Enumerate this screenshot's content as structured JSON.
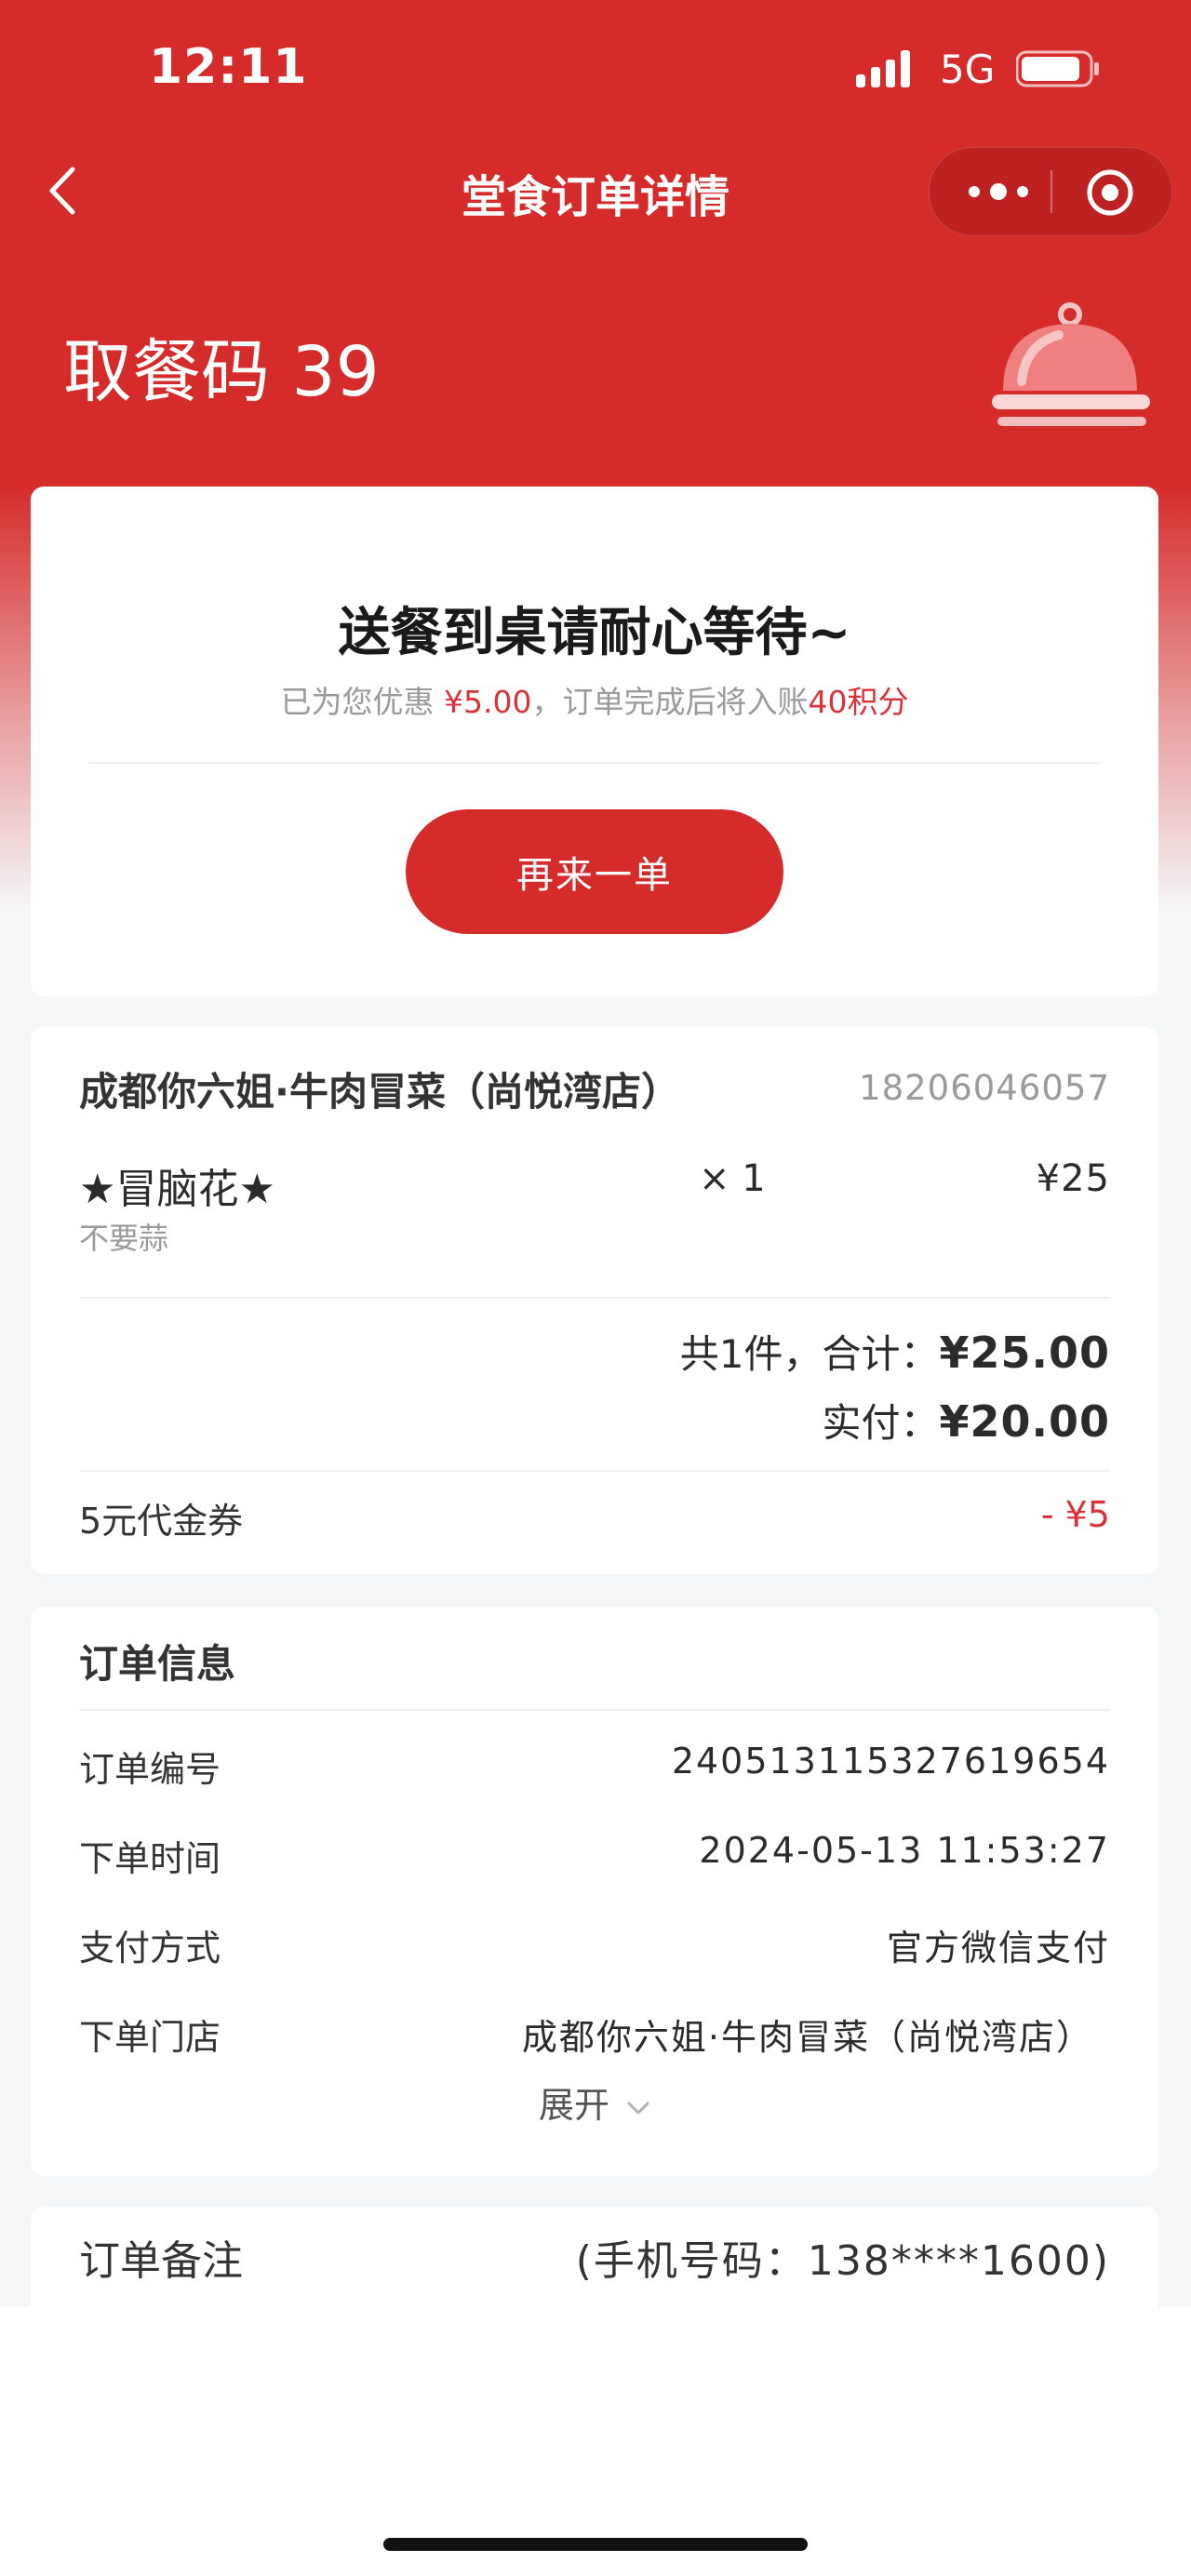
{
  "status_bar": {
    "time": "12:11",
    "network": "5G",
    "icons": [
      "signal-icon",
      "battery-icon"
    ]
  },
  "nav": {
    "title": "堂食订单详情",
    "back_icon": "chevron-left-icon",
    "more_icon": "more-dots-icon",
    "close_icon": "target-icon"
  },
  "pickup": {
    "text": "取餐码 39",
    "illustration": "food-cloche-icon"
  },
  "status_card": {
    "heading": "送餐到桌请耐心等待~",
    "note_prefix": "已为您优惠 ",
    "note_discount": "¥5.00",
    "note_middle": "，订单完成后将入账",
    "note_points": "40积分",
    "reorder_label": "再来一单"
  },
  "order_card": {
    "store_name": "成都你六姐·牛肉冒菜（尚悦湾店）",
    "store_phone": "18206046057",
    "items": [
      {
        "name": "★冒脑花★",
        "spec": "不要蒜",
        "qty": "× 1",
        "price": "¥25"
      }
    ],
    "total_prefix": "共1件，合计：",
    "total_amount": "¥25.00",
    "paid_prefix": "实付：",
    "paid_amount": "¥20.00",
    "coupon_label": "5元代金券",
    "coupon_value": "- ¥5"
  },
  "info_card": {
    "title": "订单信息",
    "rows": [
      {
        "label": "订单编号",
        "value": "240513115327619654"
      },
      {
        "label": "下单时间",
        "value": "2024-05-13 11:53:27"
      },
      {
        "label": "支付方式",
        "value": "官方微信支付"
      },
      {
        "label": "下单门店",
        "value": "成都你六姐·牛肉冒菜（尚悦湾店）"
      }
    ],
    "expand_label": "展开"
  },
  "remark_card": {
    "label": "订单备注",
    "value": "(手机号码：138****1600)"
  },
  "colors": {
    "brand_red": "#d52b2b",
    "accent_red": "#d8333a",
    "background": "#f5f6f8"
  }
}
